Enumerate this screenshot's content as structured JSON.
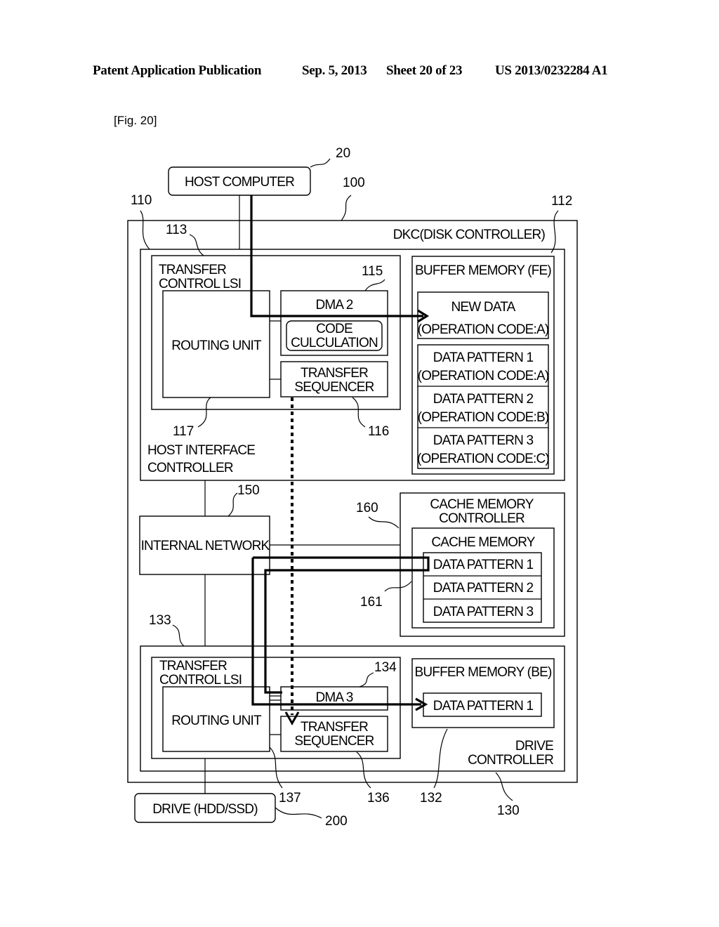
{
  "header": {
    "publication": "Patent Application Publication",
    "date": "Sep. 5, 2013",
    "sheet": "Sheet 20 of 23",
    "number": "US 2013/0232284 A1"
  },
  "figure_label": "[Fig. 20]",
  "nodes": {
    "host_computer": "HOST COMPUTER",
    "dkc": "DKC(DISK CONTROLLER)",
    "transfer_lsi_top": [
      "TRANSFER",
      "CONTROL LSI"
    ],
    "routing_unit_top": "ROUTING UNIT",
    "dma2": "DMA 2",
    "code_calc": [
      "CODE",
      "CULCULATION"
    ],
    "transfer_seq_top": [
      "TRANSFER",
      "SEQUENCER"
    ],
    "host_if_ctrl": [
      "HOST INTERFACE",
      "CONTROLLER"
    ],
    "buffer_fe": "BUFFER MEMORY (FE)",
    "buffer_fe_items": [
      [
        "NEW DATA",
        "(OPERATION CODE:A)"
      ],
      [
        "DATA PATTERN 1",
        "(OPERATION CODE:A)"
      ],
      [
        "DATA PATTERN 2",
        "(OPERATION CODE:B)"
      ],
      [
        "DATA PATTERN 3",
        "(OPERATION CODE:C)"
      ]
    ],
    "internal_network": "INTERNAL NETWORK",
    "cache_ctrl": [
      "CACHE MEMORY",
      "CONTROLLER"
    ],
    "cache_memory": "CACHE MEMORY",
    "cache_items": [
      "DATA PATTERN 1",
      "DATA PATTERN 2",
      "DATA PATTERN 3"
    ],
    "transfer_lsi_bottom": [
      "TRANSFER",
      "CONTROL LSI"
    ],
    "routing_unit_bottom": "ROUTING UNIT",
    "dma3": "DMA 3",
    "transfer_seq_bottom": [
      "TRANSFER",
      "SEQUENCER"
    ],
    "buffer_be": "BUFFER MEMORY (BE)",
    "buffer_be_item": "DATA PATTERN 1",
    "drive_ctrl": [
      "DRIVE",
      "CONTROLLER"
    ],
    "drive": "DRIVE (HDD/SSD)"
  },
  "refs": {
    "r20": "20",
    "r100": "100",
    "r110": "110",
    "r112": "112",
    "r113": "113",
    "r115": "115",
    "r116": "116",
    "r117": "117",
    "r150": "150",
    "r160": "160",
    "r161": "161",
    "r133": "133",
    "r134": "134",
    "r137": "137",
    "r136": "136",
    "r132": "132",
    "r130": "130",
    "r200": "200"
  }
}
